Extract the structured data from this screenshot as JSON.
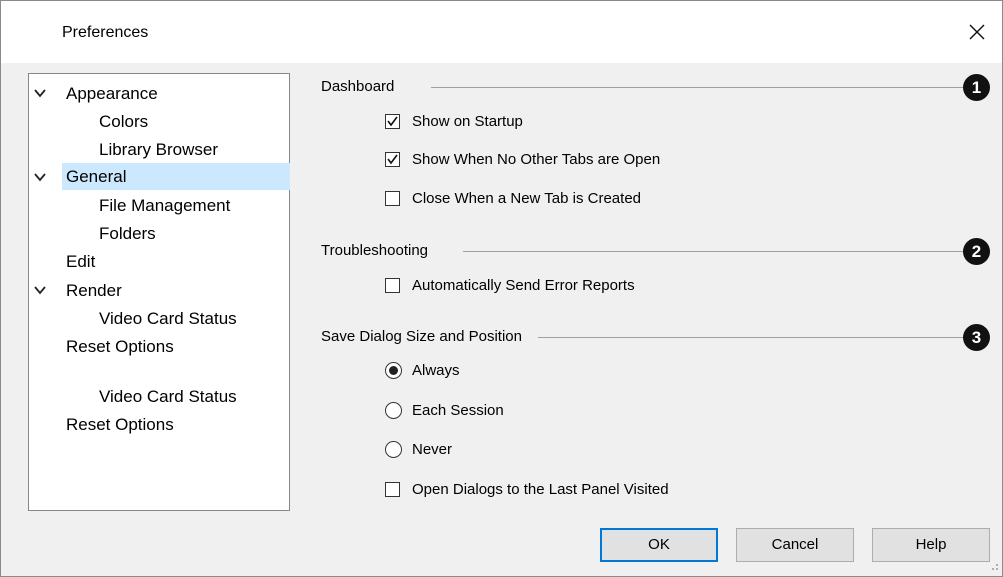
{
  "window": {
    "title": "Preferences"
  },
  "tree": {
    "items": [
      {
        "label": "Appearance",
        "expandable": true,
        "icon": "chevron-down-icon"
      },
      {
        "label": "Colors"
      },
      {
        "label": "Library Browser"
      },
      {
        "label": "General",
        "expandable": true,
        "selected": true,
        "icon": "chevron-down-icon"
      },
      {
        "label": "File Management"
      },
      {
        "label": "Folders"
      },
      {
        "label": "Edit"
      },
      {
        "label": "Render",
        "expandable": true,
        "icon": "chevron-down-icon"
      },
      {
        "label": "Video Card Status"
      },
      {
        "label": "Reset Options"
      },
      {
        "label": "Video Card Status"
      },
      {
        "label": "Reset Options"
      }
    ]
  },
  "sections": {
    "dashboard": {
      "title": "Dashboard",
      "badge": "1",
      "options": [
        {
          "label": "Show on Startup",
          "type": "checkbox",
          "checked": true
        },
        {
          "label": "Show When No Other Tabs are Open",
          "type": "checkbox",
          "checked": true
        },
        {
          "label": "Close When a New Tab is Created",
          "type": "checkbox",
          "checked": false
        }
      ]
    },
    "troubleshooting": {
      "title": "Troubleshooting",
      "badge": "2",
      "options": [
        {
          "label": "Automatically Send Error Reports",
          "type": "checkbox",
          "checked": false
        }
      ]
    },
    "save_dialog": {
      "title": "Save Dialog Size and Position",
      "badge": "3",
      "options": [
        {
          "label": "Always",
          "type": "radio",
          "checked": true
        },
        {
          "label": "Each Session",
          "type": "radio",
          "checked": false
        },
        {
          "label": "Never",
          "type": "radio",
          "checked": false
        },
        {
          "label": "Open Dialogs to the Last Panel Visited",
          "type": "checkbox",
          "checked": false
        }
      ]
    }
  },
  "buttons": {
    "ok": "OK",
    "cancel": "Cancel",
    "help": "Help"
  },
  "colors": {
    "selection": "#cce8ff",
    "default_button_border": "#0078d7",
    "badge": "#111111"
  }
}
